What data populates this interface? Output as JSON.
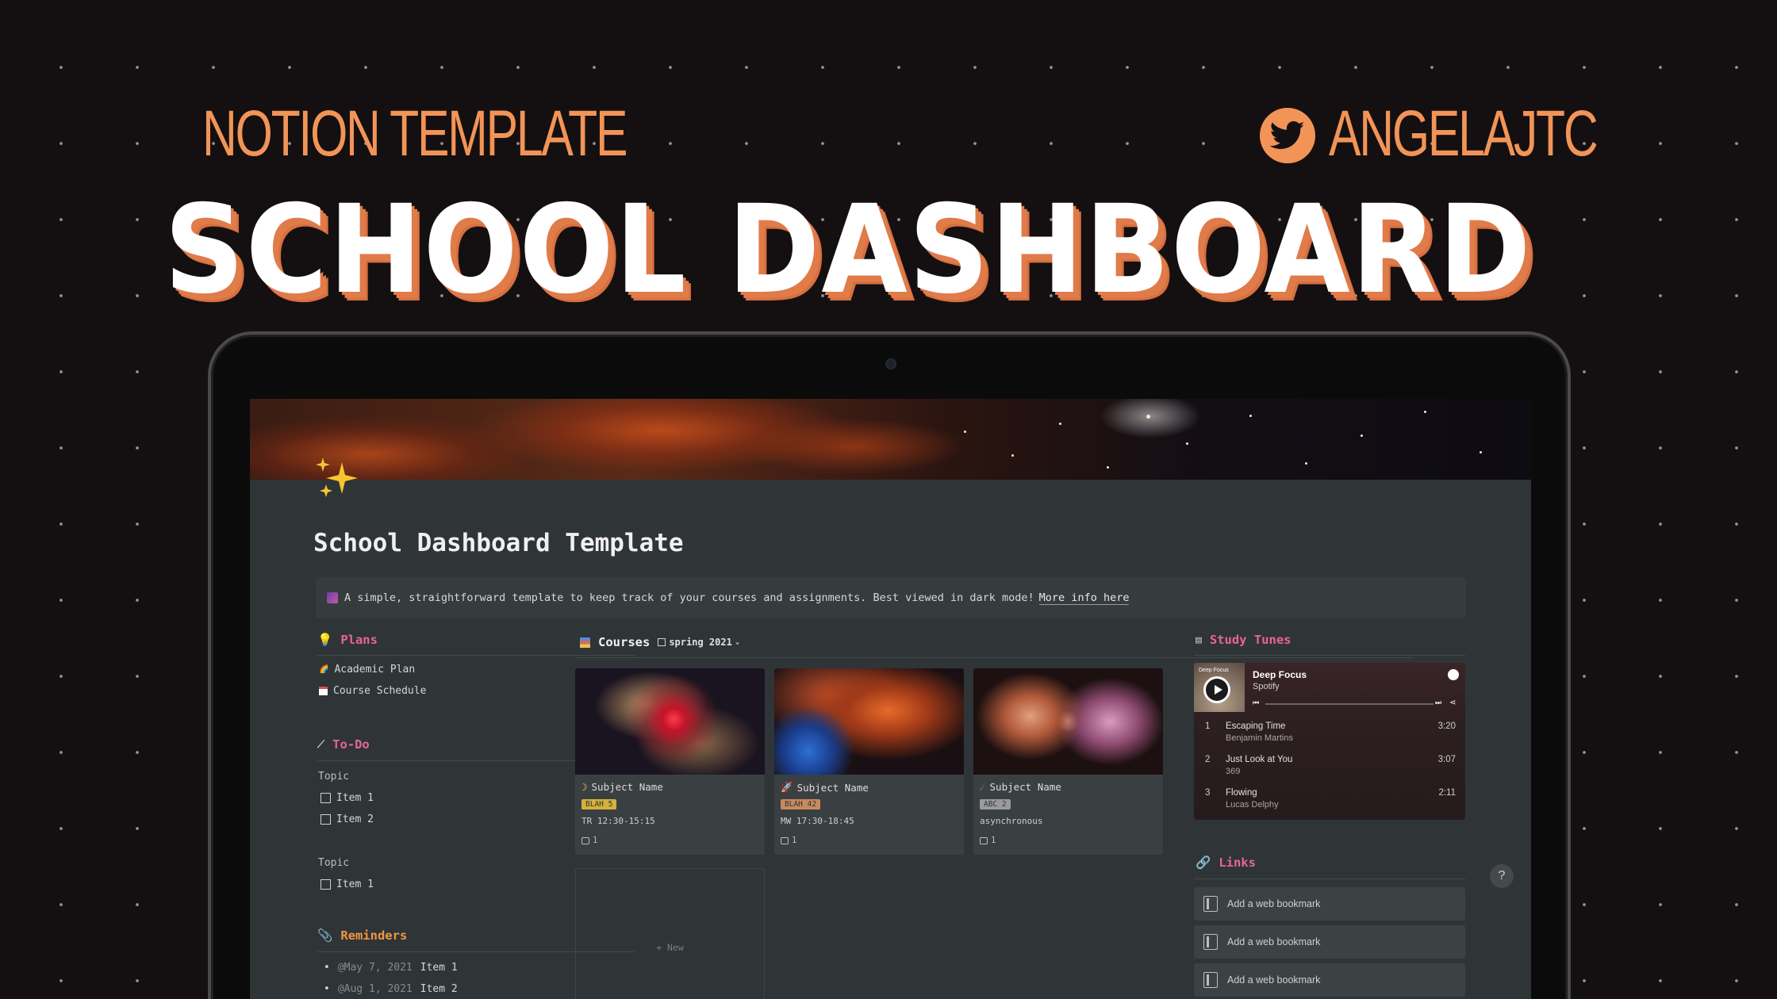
{
  "hero": {
    "subtitle": "NOTION TEMPLATE",
    "handle": "ANGELAJTC",
    "title": "SCHOOL DASHBOARD",
    "accent_color": "#f29457",
    "icon": "twitter-icon"
  },
  "page": {
    "icon": "sparkles-icon",
    "title": "School Dashboard Template",
    "callout": {
      "icon": "galaxy-icon",
      "text": "A simple, straightforward template to keep track of your courses and assignments. Best viewed in dark mode!",
      "link": "More info here"
    }
  },
  "plans": {
    "heading": "Plans",
    "icon": "lightbulb-icon",
    "items": [
      {
        "icon": "rainbow-icon",
        "label": "Academic Plan"
      },
      {
        "icon": "calendar-icon",
        "label": "Course Schedule"
      }
    ]
  },
  "todo": {
    "heading": "To-Do",
    "icon": "magic-wand-icon",
    "groups": [
      {
        "topic": "Topic",
        "items": [
          "Item 1",
          "Item 2"
        ]
      },
      {
        "topic": "Topic",
        "items": [
          "Item 1"
        ]
      }
    ]
  },
  "reminders": {
    "heading": "Reminders",
    "icon": "paperclip-icon",
    "items": [
      {
        "date": "@May 7, 2021",
        "label": "Item 1"
      },
      {
        "date": "@Aug 1, 2021",
        "label": "Item 2"
      }
    ]
  },
  "courses": {
    "heading": "Courses",
    "icon": "books-icon",
    "view": "spring 2021",
    "new_label": "+ New",
    "cards": [
      {
        "icon": "moon-icon",
        "name": "Subject Name",
        "tag": "BLAH 5",
        "tag_color": "#d4b13a",
        "time": "TR 12:30-15:15",
        "comments": "1"
      },
      {
        "icon": "rocket-icon",
        "name": "Subject Name",
        "tag": "BLAH 42",
        "tag_color": "#c98a5e",
        "time": "MW 17:30-18:45",
        "comments": "1"
      },
      {
        "icon": "comet-icon",
        "name": "Subject Name",
        "tag": "ABC 2",
        "tag_color": "#9a9a9a",
        "time": "asynchronous",
        "comments": "1"
      }
    ]
  },
  "study_tunes": {
    "heading": "Study Tunes",
    "icon": "music-icon",
    "playlist": "Deep Focus",
    "source": "Spotify",
    "cover_label": "Deep Focus",
    "tracks": [
      {
        "num": "1",
        "title": "Escaping Time",
        "artist": "Benjamin Martins",
        "duration": "3:20"
      },
      {
        "num": "2",
        "title": "Just Look at You",
        "artist": "369",
        "duration": "3:07"
      },
      {
        "num": "3",
        "title": "Flowing",
        "artist": "Lucas Delphy",
        "duration": "2:11"
      }
    ]
  },
  "links": {
    "heading": "Links",
    "icon": "link-icon",
    "bookmarks": [
      "Add a web bookmark",
      "Add a web bookmark",
      "Add a web bookmark"
    ]
  },
  "help": "?"
}
